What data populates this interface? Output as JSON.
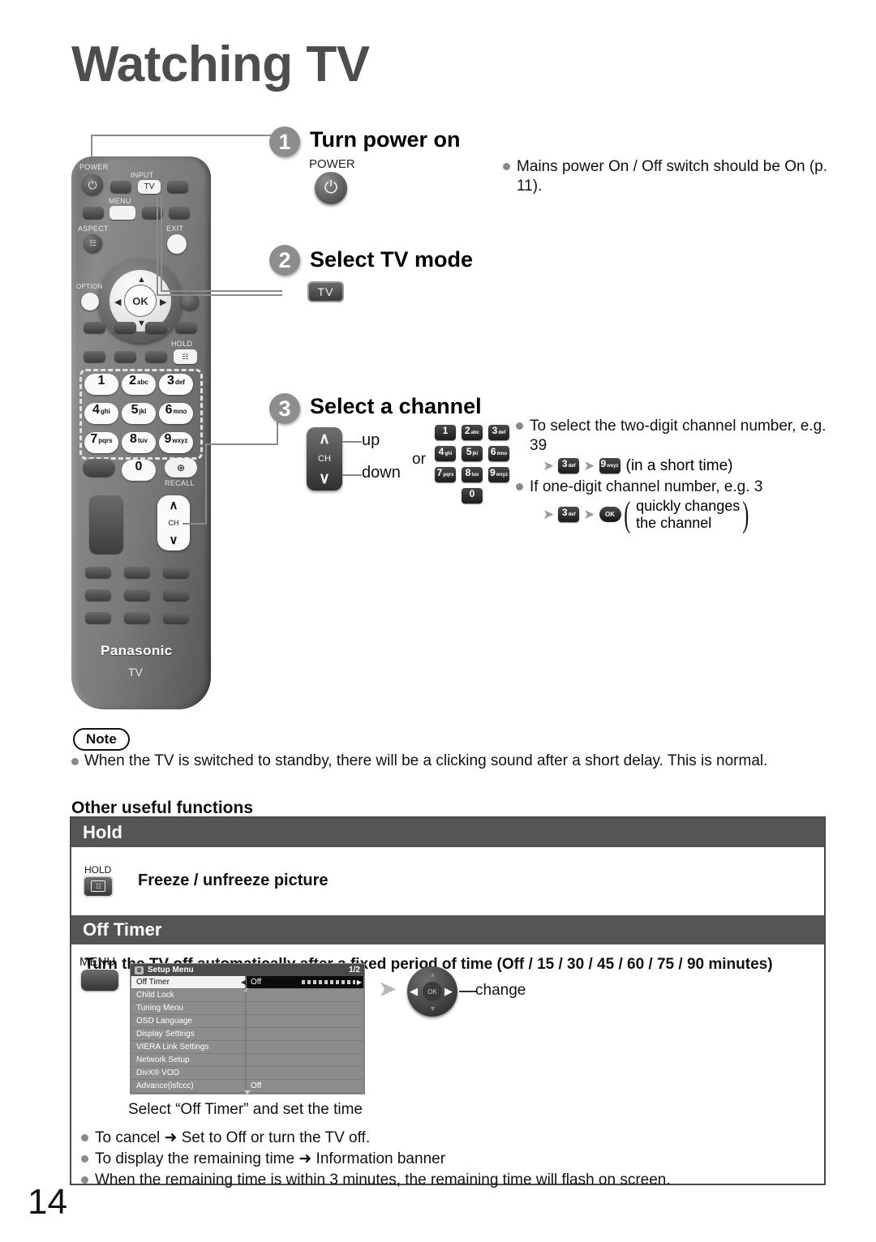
{
  "page": {
    "title": "Watching TV",
    "number": "14"
  },
  "steps": [
    {
      "num": "1",
      "title": "Turn power on",
      "button_caption": "POWER",
      "bullets": [
        "Mains power On / Off switch should be On (p. 11)."
      ]
    },
    {
      "num": "2",
      "title": "Select TV mode",
      "button_label": "TV"
    },
    {
      "num": "3",
      "title": "Select a channel",
      "ch_label": "CH",
      "up_label": "up",
      "down_label": "down",
      "or_label": "or",
      "bullet1": "To select the two-digit channel number, e.g. 39",
      "bullet1_suffix": "(in a short time)",
      "bullet2": "If one-digit channel number, e.g. 3",
      "brace_line1": "quickly changes",
      "brace_line2": "the channel",
      "keypad": [
        {
          "d": "1",
          "s": ""
        },
        {
          "d": "2",
          "s": "abc"
        },
        {
          "d": "3",
          "s": "def"
        },
        {
          "d": "4",
          "s": "ghi"
        },
        {
          "d": "5",
          "s": "jkl"
        },
        {
          "d": "6",
          "s": "mno"
        },
        {
          "d": "7",
          "s": "pqrs"
        },
        {
          "d": "8",
          "s": "tuv"
        },
        {
          "d": "9",
          "s": "wxyz"
        },
        {
          "d": "0",
          "s": ""
        }
      ],
      "seq1": [
        {
          "d": "3",
          "s": "def"
        },
        {
          "d": "9",
          "s": "wxyz"
        }
      ],
      "seq2_key": {
        "d": "3",
        "s": "def"
      },
      "seq2_ok": "OK"
    }
  ],
  "remote": {
    "labels": {
      "power": "POWER",
      "input": "INPUT",
      "tv": "TV",
      "menu": "MENU",
      "aspect": "ASPECT",
      "exit": "EXIT",
      "option": "OPTION",
      "hold": "HOLD",
      "recall": "RECALL",
      "ch": "CH",
      "ok": "OK"
    },
    "keypad": [
      {
        "d": "1",
        "s": ""
      },
      {
        "d": "2",
        "s": "abc"
      },
      {
        "d": "3",
        "s": "def"
      },
      {
        "d": "4",
        "s": "ghi"
      },
      {
        "d": "5",
        "s": "jkl"
      },
      {
        "d": "6",
        "s": "mno"
      },
      {
        "d": "7",
        "s": "pqrs"
      },
      {
        "d": "8",
        "s": "tuv"
      },
      {
        "d": "9",
        "s": "wxyz"
      },
      {
        "d": "0",
        "s": ""
      }
    ],
    "brand": "Panasonic",
    "brand_sub": "TV"
  },
  "note": {
    "label": "Note",
    "text": "When the TV is switched to standby, there will be a clicking sound after a short delay. This is normal."
  },
  "other_functions": {
    "heading": "Other useful functions",
    "hold": {
      "header": "Hold",
      "button_caption": "HOLD",
      "text": "Freeze / unfreeze picture"
    },
    "off_timer": {
      "header": "Off Timer",
      "description": "Turn the TV off automatically after a fixed period of time (Off / 15 / 30 / 45 / 60 / 75 / 90 minutes)",
      "menu_caption": "MENU",
      "change_label": "change",
      "select_line": "Select “Off Timer” and set the time",
      "bullets": [
        "To cancel ➜ Set to Off or turn the TV off.",
        "To display the remaining time ➜ Information banner",
        "When the remaining time is within 3 minutes, the remaining time will flash on screen."
      ]
    }
  },
  "osd": {
    "title": "Setup Menu",
    "page_indicator": "1/2",
    "rows": [
      {
        "name": "Off Timer",
        "value": "Off",
        "selected": true
      },
      {
        "name": "Child Lock",
        "value": "",
        "selected": false
      },
      {
        "name": "Tuning Menu",
        "value": "",
        "selected": false
      },
      {
        "name": "OSD Language",
        "value": "",
        "selected": false
      },
      {
        "name": "Display Settings",
        "value": "",
        "selected": false
      },
      {
        "name": "VIERA Link Settings",
        "value": "",
        "selected": false
      },
      {
        "name": "Network Setup",
        "value": "",
        "selected": false
      },
      {
        "name": "DivX® VOD",
        "value": "",
        "selected": false
      },
      {
        "name": "Advance(isfccc)",
        "value": "Off",
        "selected": false
      }
    ]
  },
  "colors": {
    "header_bar": "#555555",
    "step_circle": "#8d8d8d",
    "title_gray": "#4d4d4d"
  }
}
